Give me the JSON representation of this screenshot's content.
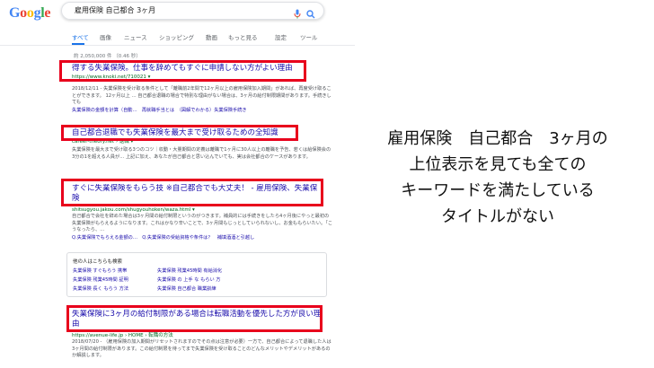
{
  "logo_text": "Google",
  "search": {
    "query": "雇用保険 自己都合 3ヶ月"
  },
  "tabs": [
    "すべて",
    "画像",
    "ニュース",
    "ショッピング",
    "動画",
    "もっと見る",
    "設定",
    "ツール"
  ],
  "stats": "約 2,050,000 件 （0.46 秒）",
  "results": [
    {
      "title": "得する失業保険。仕事を辞めてもすぐに申請しない方がよい理由",
      "url": "https://www.knoki.net/710021 ▾",
      "snippet": "2018/12/11 - 失業保険を受け取る条件として「離職前2年間で12ヶ月以上の雇用保険加入期間」があれば、再度受け取ることができます。 12ヶ月以上 … 自己都合退職の場合で特別な理由がない場合は、3ヶ月の給付制限期間があります。手続きしても",
      "links": "失業保険の金額を計算（自動…　再就職手当とは　（図解でわかる）失業保険手続き"
    },
    {
      "title": "自己都合退職でも失業保険を最大まで受け取るための全知識",
      "url": "career-theory.net › 退職 ▾",
      "snippet": "失業保険を最大まで受け取る3つのコツ｜収動・大量期間の定義は離職で1ヶ月に30人以上の離職を予告、若くは給保険会の3分の1を超える人員が… 上記に加え、あなたが自己都合と思い込んでいても、実は会社都合のケースがあります。",
      "links": ""
    },
    {
      "title": "すぐに失業保険をもらう技 ※自己都合でも大丈夫！ - 雇用保険、失業保険",
      "url": "shitsugyou.jakou.com/shugyouhoken/waza.html ▾",
      "snippet": "自己都合で会社を辞めた場合は3ヶ月間の給付制限というのがつきます。補員的には手続きをしたら4ヶ月後にやっと最初の失業保険がもらえるようになります。これはかなり辛いことで、3ヶ月間もじっとしていられないし、お金ももらいたい。「こうなったら、…",
      "links": "Q.失業保険でもらえる金額の…　Q.失業保険の受給資格や条件は？　補填酒酒と引越し"
    },
    {
      "title": "失業保険に3ヶ月の給付制限がある場合は転職活動を優先した方が良い理由",
      "url": "https://avenue-life.jp › HOME › 転職の方法",
      "snippet": "2018/07/20 - （雇用保険の加入期間がリセットされますのでその点は注意が必要）一方で、自己都合によって退職した人は3ヶ月間の給付制限があります。この給付制限を待ってまで失業保険を受け取ることのどんなメリットやデメリットがあるのか解説します。",
      "links": ""
    }
  ],
  "paa": {
    "title": "他の人はこちらも検索",
    "items": [
      "失業保険 すぐもらう 携帯",
      "失業保険 残業45時間 有給消化",
      "失業保険 残業45時間 証明",
      "失業保険 の 上手 な もらい 方",
      "失業保険 長く もらう 方法",
      "失業保険 自己都合 職業訓練"
    ]
  },
  "annotation": {
    "lines": [
      "雇用保険　自己都合　3ヶ月の",
      "上位表示を見ても全ての",
      "キーワードを満たしている",
      "タイトルがない"
    ]
  },
  "colors": {
    "highlight_border": "#e8001c",
    "link_blue": "#1a0dab",
    "url_green": "#006621",
    "active_tab": "#1a73e8"
  }
}
